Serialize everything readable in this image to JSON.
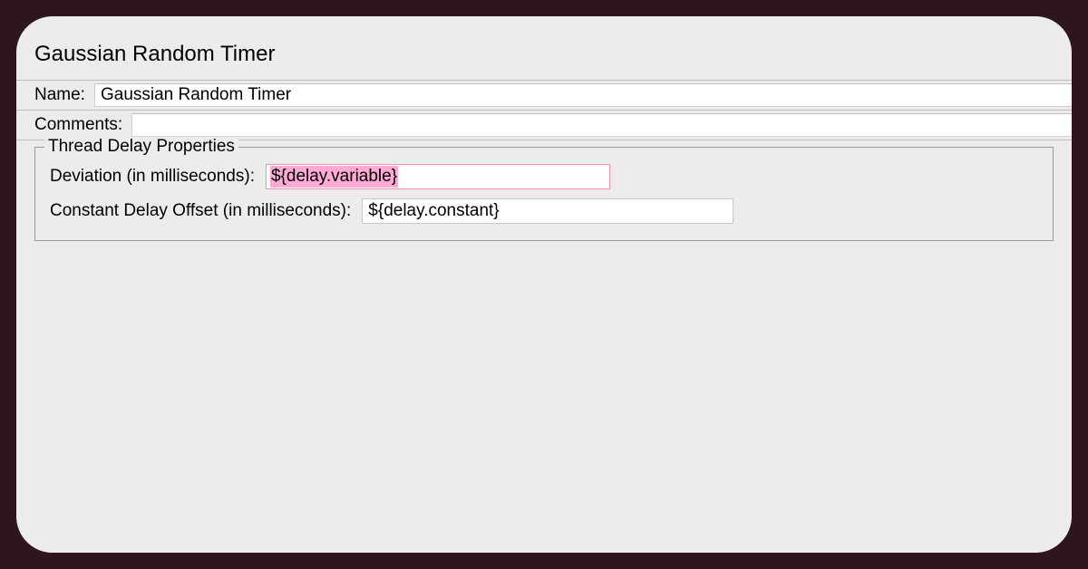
{
  "title": "Gaussian Random Timer",
  "name": {
    "label": "Name:",
    "value": "Gaussian Random Timer"
  },
  "comments": {
    "label": "Comments:",
    "value": ""
  },
  "threadDelay": {
    "legend": "Thread Delay Properties",
    "deviation": {
      "label": "Deviation (in milliseconds):",
      "value": "${delay.variable}"
    },
    "constantOffset": {
      "label": "Constant Delay Offset (in milliseconds):",
      "value": "${delay.constant}"
    }
  }
}
